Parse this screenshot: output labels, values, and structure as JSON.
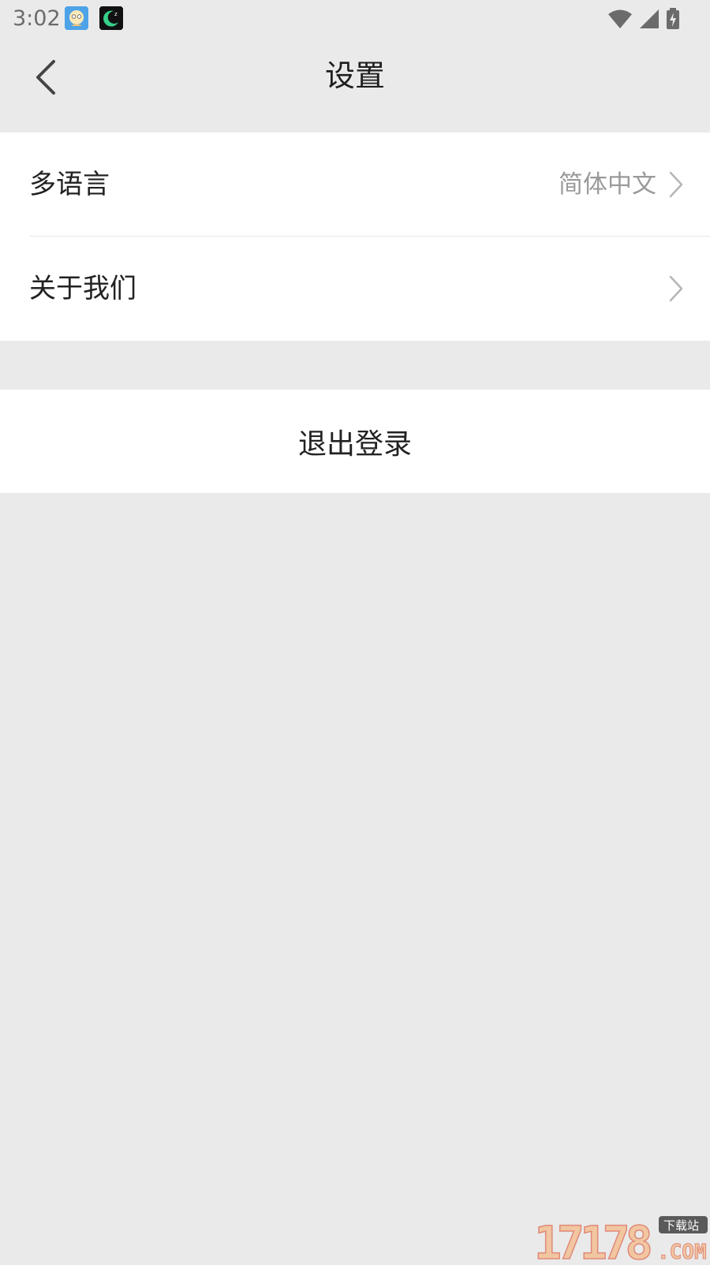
{
  "status_bar": {
    "time": "3:02",
    "icons": [
      "app-notification-icon",
      "sleep-app-icon",
      "wifi-icon",
      "cellular-signal-icon",
      "battery-charging-icon"
    ]
  },
  "header": {
    "title": "设置",
    "back_icon": "chevron-left-icon"
  },
  "settings": {
    "items": [
      {
        "label": "多语言",
        "value": "简体中文"
      },
      {
        "label": "关于我们",
        "value": ""
      }
    ]
  },
  "logout": {
    "label": "退出登录"
  },
  "watermark": {
    "text": "17178",
    "sub": "下载站",
    "domain": ".COM"
  },
  "colors": {
    "background": "#eaeaea",
    "card": "#ffffff",
    "text_primary": "#222222",
    "text_secondary": "#9a9a9a"
  }
}
